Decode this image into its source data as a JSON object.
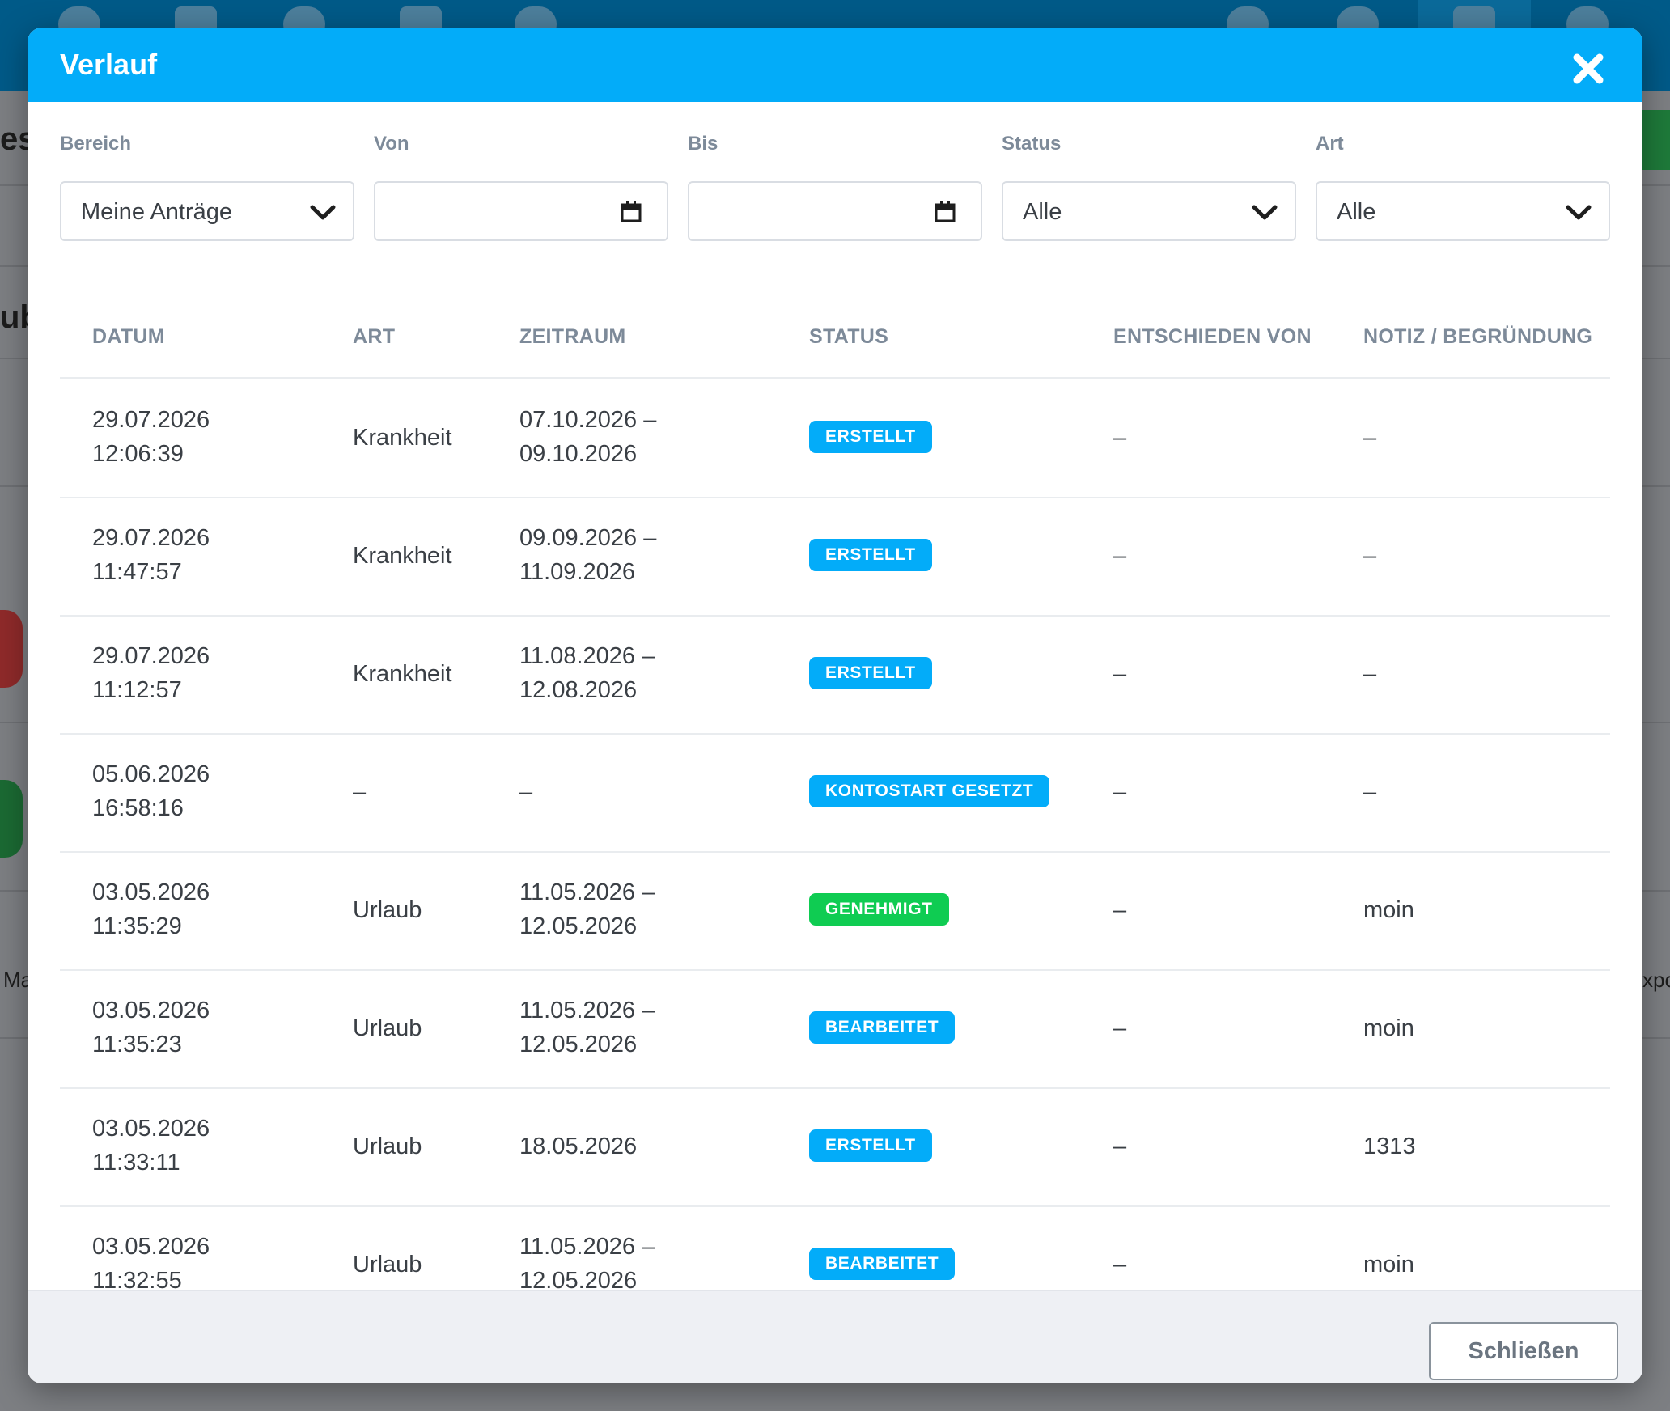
{
  "modal": {
    "title": "Verlauf",
    "close_label": "Schließen"
  },
  "filters": [
    {
      "label": "Bereich",
      "value": "Meine Anträge",
      "kind": "select"
    },
    {
      "label": "Von",
      "value": "",
      "kind": "date"
    },
    {
      "label": "Bis",
      "value": "",
      "kind": "date"
    },
    {
      "label": "Status",
      "value": "Alle",
      "kind": "select"
    },
    {
      "label": "Art",
      "value": "Alle",
      "kind": "select"
    }
  ],
  "table": {
    "columns": [
      "DATUM",
      "ART",
      "ZEITRAUM",
      "STATUS",
      "ENTSCHIEDEN VON",
      "NOTIZ / BEGRÜNDUNG"
    ],
    "rows": [
      {
        "date": "29.07.2026",
        "time": "12:06:39",
        "art": "Krankheit",
        "from": "07.10.2026 –",
        "to": "09.10.2026",
        "status": "ERSTELLT",
        "status_color": "#03acf9",
        "decided_by": "–",
        "note": "–"
      },
      {
        "date": "29.07.2026",
        "time": "11:47:57",
        "art": "Krankheit",
        "from": "09.09.2026 –",
        "to": "11.09.2026",
        "status": "ERSTELLT",
        "status_color": "#03acf9",
        "decided_by": "–",
        "note": "–"
      },
      {
        "date": "29.07.2026",
        "time": "11:12:57",
        "art": "Krankheit",
        "from": "11.08.2026 –",
        "to": "12.08.2026",
        "status": "ERSTELLT",
        "status_color": "#03acf9",
        "decided_by": "–",
        "note": "–"
      },
      {
        "date": "05.06.2026",
        "time": "16:58:16",
        "art": "–",
        "from": "–",
        "to": "",
        "status": "KONTOSTART GESETZT",
        "status_color": "#03acf9",
        "decided_by": "–",
        "note": "–"
      },
      {
        "date": "03.05.2026",
        "time": "11:35:29",
        "art": "Urlaub",
        "from": "11.05.2026 –",
        "to": "12.05.2026",
        "status": "GENEHMIGT",
        "status_color": "#0fcc52",
        "decided_by": "–",
        "note": "moin"
      },
      {
        "date": "03.05.2026",
        "time": "11:35:23",
        "art": "Urlaub",
        "from": "11.05.2026 –",
        "to": "12.05.2026",
        "status": "BEARBEITET",
        "status_color": "#03acf9",
        "decided_by": "–",
        "note": "moin"
      },
      {
        "date": "03.05.2026",
        "time": "11:33:11",
        "art": "Urlaub",
        "from": "18.05.2026",
        "to": "",
        "status": "ERSTELLT",
        "status_color": "#03acf9",
        "decided_by": "–",
        "note": "1313"
      },
      {
        "date": "03.05.2026",
        "time": "11:32:55",
        "art": "Urlaub",
        "from": "11.05.2026 –",
        "to": "12.05.2026",
        "status": "BEARBEITET",
        "status_color": "#03acf9",
        "decided_by": "–",
        "note": "moin"
      }
    ]
  },
  "background": {
    "left_fragments": [
      "es",
      "ub",
      "Ma"
    ],
    "right_fragment": "xpo"
  }
}
